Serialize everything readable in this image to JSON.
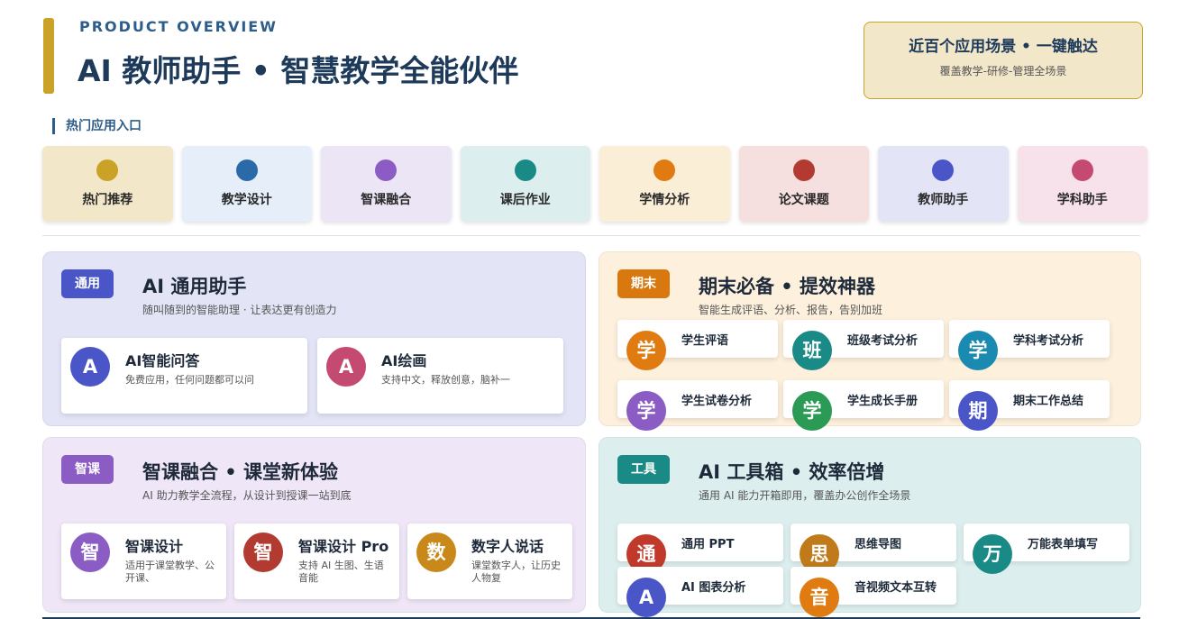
{
  "header": {
    "overview": "PRODUCT OVERVIEW",
    "title": "AI 教师助手 • 智慧教学全能伙伴",
    "accent_color": "#c9a227"
  },
  "promo": {
    "title": "近百个应用场景 • 一键触达",
    "subtitle": "覆盖教学-研修-管理全场景"
  },
  "hot_section": {
    "label": "热门应用入口",
    "tiles": [
      {
        "label": "热门推荐",
        "bg": "#f3e7c9",
        "dot": "#c9a227"
      },
      {
        "label": "教学设计",
        "bg": "#e6eef9",
        "dot": "#2b6aa8"
      },
      {
        "label": "智课融合",
        "bg": "#ece5f6",
        "dot": "#8a5cc4"
      },
      {
        "label": "课后作业",
        "bg": "#dcefee",
        "dot": "#1a8a87"
      },
      {
        "label": "学情分析",
        "bg": "#fbeed7",
        "dot": "#e07b12"
      },
      {
        "label": "论文课题",
        "bg": "#f6e0df",
        "dot": "#b33a30"
      },
      {
        "label": "教师助手",
        "bg": "#e3e5f7",
        "dot": "#4a56c8"
      },
      {
        "label": "学科助手",
        "bg": "#f7e1ea",
        "dot": "#c44a72"
      }
    ]
  },
  "panels": {
    "general": {
      "badge": "通用",
      "badge_color": "#4a56c8",
      "bg": "#e3e5f7",
      "title": "AI 通用助手",
      "subtitle": "随叫随到的智能助理 · 让表达更有创造力",
      "cards": [
        {
          "icon": "A",
          "icon_color": "#4a56c8",
          "title": "AI智能问答",
          "desc": "免费应用，任何问题都可以问"
        },
        {
          "icon": "A",
          "icon_color": "#c44a72",
          "title": "AI绘画",
          "desc": "支持中文，释放创意，脑补一"
        }
      ]
    },
    "final": {
      "badge": "期末",
      "badge_color": "#d9780e",
      "bg": "#fdf0dc",
      "title": "期末必备 • 提效神器",
      "subtitle": "智能生成评语、分析、报告，告别加班",
      "items": [
        {
          "icon": "学",
          "icon_color": "#e07b12",
          "label": "学生评语"
        },
        {
          "icon": "班",
          "icon_color": "#1a8a87",
          "label": "班级考试分析"
        },
        {
          "icon": "学",
          "icon_color": "#1a8ab0",
          "label": "学科考试分析"
        },
        {
          "icon": "学",
          "icon_color": "#8a5cc4",
          "label": "学生试卷分析"
        },
        {
          "icon": "学",
          "icon_color": "#2a9a55",
          "label": "学生成长手册"
        },
        {
          "icon": "期",
          "icon_color": "#4a56c8",
          "label": "期末工作总结"
        }
      ]
    },
    "smart": {
      "badge": "智课",
      "badge_color": "#8a5cc4",
      "bg": "#efe6f7",
      "title": "智课融合 • 课堂新体验",
      "subtitle": "AI 助力教学全流程，从设计到授课一站到底",
      "cards": [
        {
          "icon": "智",
          "icon_color": "#8a5cc4",
          "title": "智课设计",
          "desc": "适用于课堂教学、公开课、"
        },
        {
          "icon": "智",
          "icon_color": "#b33a30",
          "title": "智课设计 Pro",
          "desc": "支持 AI 生图、生语音能"
        },
        {
          "icon": "数",
          "icon_color": "#c9891a",
          "title": "数字人说话",
          "desc": "课堂数字人，让历史人物复"
        }
      ]
    },
    "tools": {
      "badge": "工具",
      "badge_color": "#1a8a87",
      "bg": "#dcefee",
      "title": "AI 工具箱 • 效率倍增",
      "subtitle": "通用 AI 能力开箱即用，覆盖办公创作全场景",
      "items": [
        {
          "icon": "通",
          "icon_color": "#c0392b",
          "label": "通用 PPT"
        },
        {
          "icon": "思",
          "icon_color": "#c07a1a",
          "label": "思维导图"
        },
        {
          "icon": "万",
          "icon_color": "#1a8a87",
          "label": "万能表单填写"
        },
        {
          "icon": "A",
          "icon_color": "#4a56c8",
          "label": "AI 图表分析"
        },
        {
          "icon": "音",
          "icon_color": "#e07b12",
          "label": "音视频文本互转"
        }
      ]
    }
  }
}
